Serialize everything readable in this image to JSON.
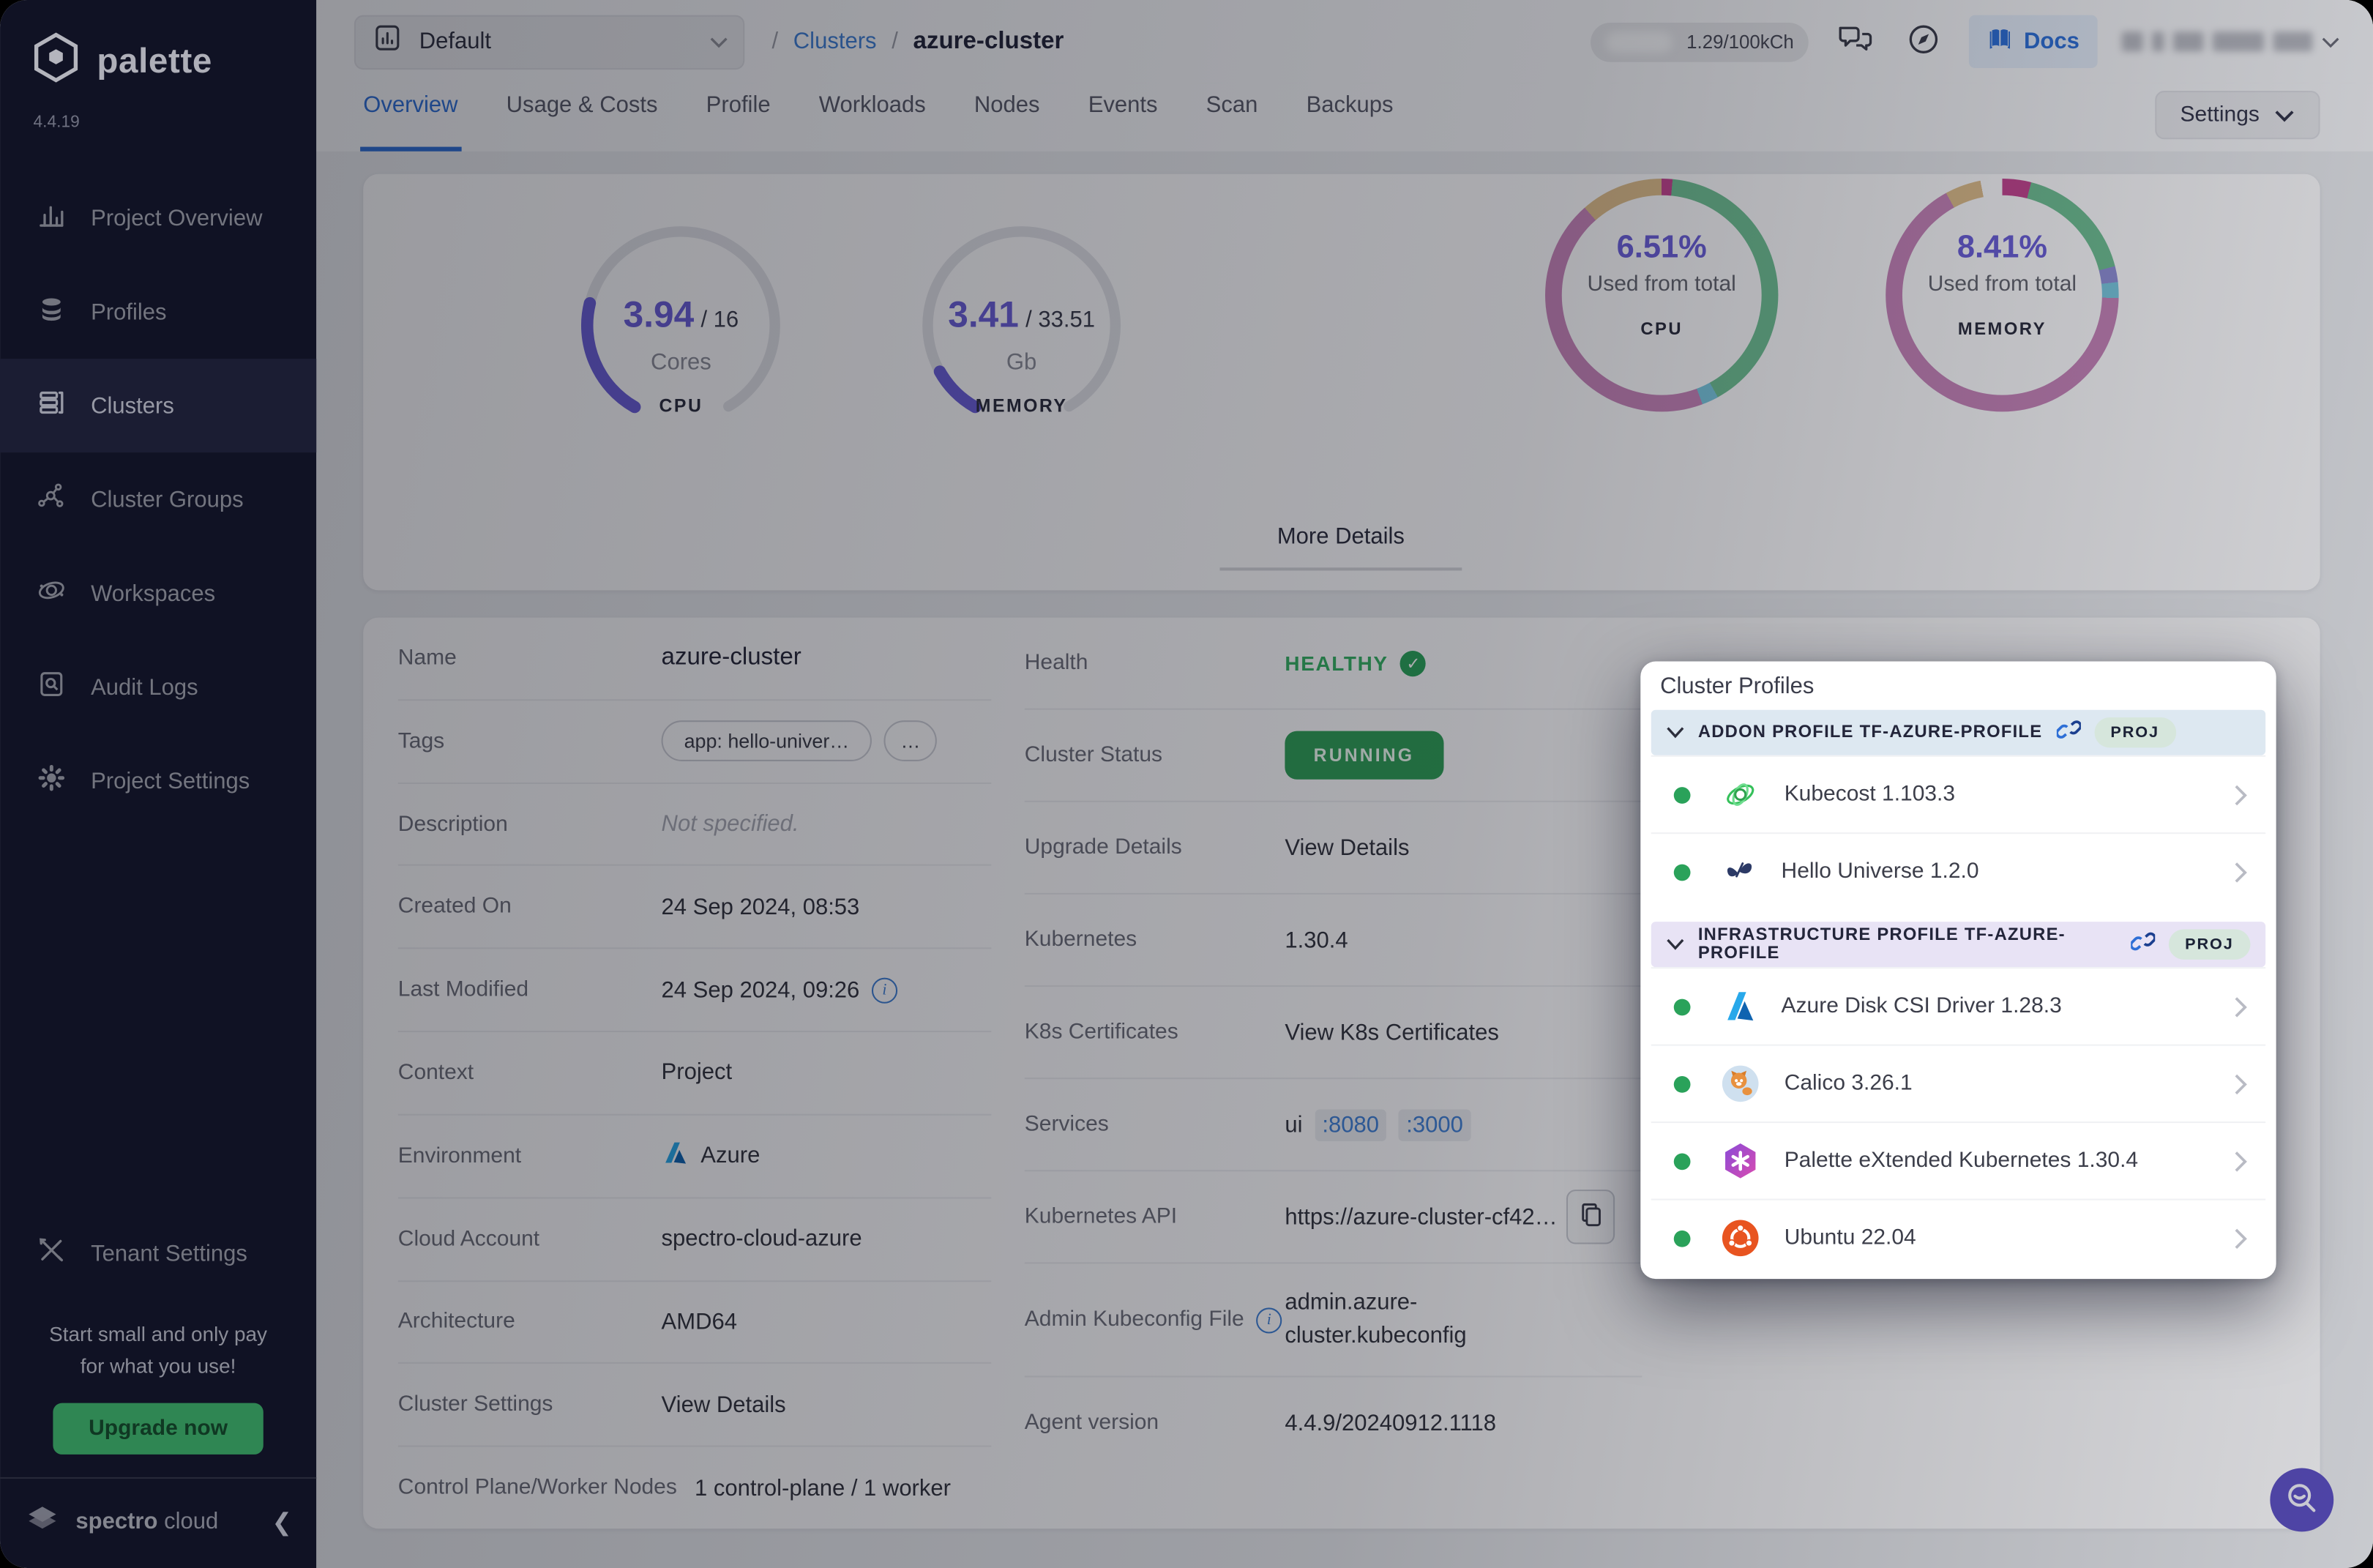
{
  "brand": {
    "name": "palette",
    "version": "4.4.19",
    "footer_name": "spectro",
    "footer_suffix": "cloud"
  },
  "sidebar": {
    "items": [
      {
        "label": "Project Overview"
      },
      {
        "label": "Profiles"
      },
      {
        "label": "Clusters"
      },
      {
        "label": "Cluster Groups"
      },
      {
        "label": "Workspaces"
      },
      {
        "label": "Audit Logs"
      },
      {
        "label": "Project Settings"
      }
    ],
    "active_item": "Clusters",
    "tenant_settings": "Tenant Settings",
    "promo_line1": "Start small and only pay",
    "promo_line2": "for what you use!",
    "upgrade_button": "Upgrade now"
  },
  "topbar": {
    "project_selector": "Default",
    "breadcrumb_sep": "/",
    "breadcrumb_section": "Clusters",
    "breadcrumb_current": "azure-cluster",
    "usage_pill": "1.29/100kCh",
    "docs_button": "Docs"
  },
  "tabs": {
    "items": [
      "Overview",
      "Usage & Costs",
      "Profile",
      "Workloads",
      "Nodes",
      "Events",
      "Scan",
      "Backups"
    ],
    "active": "Overview",
    "settings_button": "Settings"
  },
  "metrics": {
    "more_details": "More Details",
    "cpu_gauge": {
      "value": "3.94",
      "total": "/ 16",
      "unit": "Cores",
      "label": "CPU",
      "fraction": 0.246
    },
    "memory_gauge": {
      "value": "3.41",
      "total": "/ 33.51",
      "unit": "Gb",
      "label": "MEMORY",
      "fraction": 0.102
    },
    "cpu_donut": {
      "percent": "6.51%",
      "caption": "Used from total",
      "label": "CPU",
      "segments": [
        {
          "color": "#c2458f",
          "pct": 1.5
        },
        {
          "color": "#6fbf93",
          "pct": 40.5
        },
        {
          "color": "#79c7de",
          "pct": 2.3
        },
        {
          "color": "#c583b8",
          "pct": 44.2
        },
        {
          "color": "#dcbc8a",
          "pct": 11.5
        }
      ]
    },
    "memory_donut": {
      "percent": "8.41%",
      "caption": "Used from total",
      "label": "MEMORY",
      "segments": [
        {
          "color": "#c2458f",
          "pct": 4.0
        },
        {
          "color": "#6fbf93",
          "pct": 17.0
        },
        {
          "color": "#8f8fd6",
          "pct": 2.2
        },
        {
          "color": "#79c7de",
          "pct": 2.2
        },
        {
          "color": "#c583b8",
          "pct": 66.6
        },
        {
          "color": "#dcbc8a",
          "pct": 5.0
        },
        {
          "color": "#fbfbfd",
          "pct": 3.0
        }
      ]
    }
  },
  "details": {
    "left": [
      {
        "label": "Name",
        "value": "azure-cluster"
      },
      {
        "label": "Tags",
        "tag": "app: hello-univer…",
        "tag_more": "…"
      },
      {
        "label": "Description",
        "value": "Not specified."
      },
      {
        "label": "Created On",
        "value": "24 Sep 2024, 08:53"
      },
      {
        "label": "Last Modified",
        "value": "24 Sep 2024, 09:26"
      },
      {
        "label": "Context",
        "value": "Project"
      },
      {
        "label": "Environment",
        "value": "Azure"
      },
      {
        "label": "Cloud Account",
        "value": "spectro-cloud-azure"
      },
      {
        "label": "Architecture",
        "value": "AMD64"
      },
      {
        "label": "Cluster Settings",
        "value": "View Details"
      },
      {
        "label": "Control Plane/Worker Nodes",
        "value": "1 control-plane / 1 worker"
      }
    ],
    "right": {
      "health_label": "Health",
      "health_value": "HEALTHY",
      "status_label": "Cluster Status",
      "status_value": "RUNNING",
      "upgrade_label": "Upgrade Details",
      "upgrade_value": "View Details",
      "kubernetes_label": "Kubernetes",
      "kubernetes_value": "1.30.4",
      "certs_label": "K8s Certificates",
      "certs_value": "View K8s Certificates",
      "services_label": "Services",
      "services_name": "ui",
      "services_port1": ":8080",
      "services_port2": ":3000",
      "api_label": "Kubernetes API",
      "api_value": "https://azure-cluster-cf42…",
      "kubeconfig_label": "Admin Kubeconfig File",
      "kubeconfig_value": "admin.azure-cluster.kubeconfig",
      "agent_label": "Agent version",
      "agent_value": "4.4.9/20240912.1118"
    }
  },
  "popup": {
    "title": "Cluster Profiles",
    "sections": [
      {
        "header": "ADDON PROFILE TF-AZURE-PROFILE",
        "badge": "PROJ",
        "items": [
          {
            "name": "Kubecost 1.103.3"
          },
          {
            "name": "Hello Universe 1.2.0"
          }
        ]
      },
      {
        "header": "INFRASTRUCTURE PROFILE TF-AZURE-PROFILE",
        "badge": "PROJ",
        "items": [
          {
            "name": "Azure Disk CSI Driver 1.28.3"
          },
          {
            "name": "Calico 3.26.1"
          },
          {
            "name": "Palette eXtended Kubernetes 1.30.4"
          },
          {
            "name": "Ubuntu 22.04"
          }
        ]
      }
    ]
  },
  "colors": {
    "accent_indigo": "#6a5fd8",
    "link_blue": "#3f7fd4",
    "status_green": "#2f9e57",
    "badge_green_bg": "#d6e6dc",
    "addon_header_bg": "#dde8f1",
    "infra_header_bg": "#e8e3f5"
  }
}
